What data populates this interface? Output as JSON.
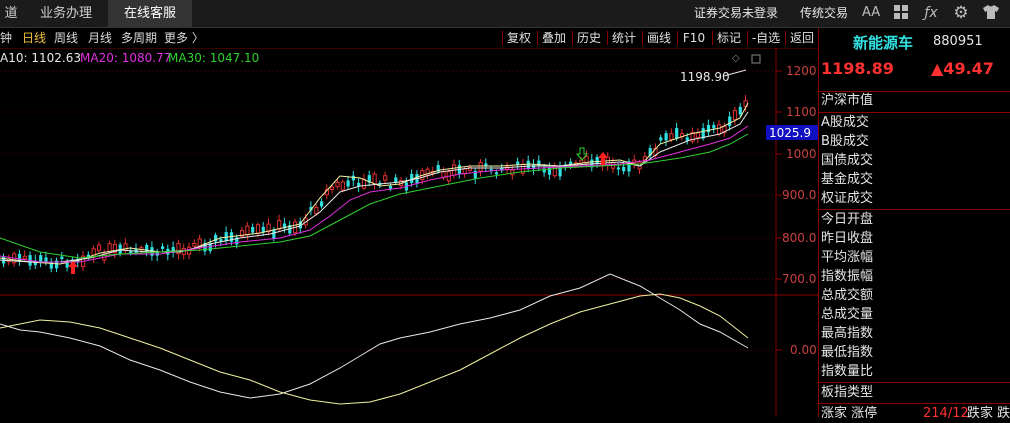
{
  "top_tabs": [
    "道",
    "业务办理",
    "在线客服"
  ],
  "top_right": {
    "login_label": "证券交易未登录",
    "classic_label": "传统交易",
    "font_size_label": "AA"
  },
  "periods": [
    "钟",
    "日线",
    "周线",
    "月线",
    "多周期",
    "更多 〉"
  ],
  "selected_period": "日线",
  "toolbar": [
    "复权",
    "叠加",
    "历史",
    "统计",
    "画线",
    "F10",
    "标记",
    "-自选",
    "返回"
  ],
  "ma_legend": [
    {
      "label": "A10: 1102.63",
      "color": "#e8e8e8"
    },
    {
      "label": "MA20: 1080.77",
      "color": "#e030e0"
    },
    {
      "label": "MA30: 1047.10",
      "color": "#30d030"
    }
  ],
  "price_axis": [
    "1200",
    "1100",
    "1000",
    "900.0",
    "800.0",
    "700.0"
  ],
  "current_price_tag": "1025.9",
  "high_annotation": "1198.90",
  "indicator_axis": [
    "0.00"
  ],
  "quote": {
    "name": "新能源车",
    "code": "880951",
    "price": "1198.89",
    "change": "▲49.47"
  },
  "panel_rows_a": [
    "沪深市值",
    "A股成交",
    "B股成交",
    "国债成交",
    "基金成交",
    "权证成交"
  ],
  "panel_rows_b": [
    "今日开盘",
    "昨日收盘",
    "平均涨幅",
    "指数振幅",
    "总成交额",
    "总成交量",
    "最高指数",
    "最低指数",
    "指数量比"
  ],
  "panel_rows_c": [
    "板指类型"
  ],
  "bottom_row": {
    "left": "涨家 涨停",
    "ratio": "214/12",
    "right": "跌家 跌"
  },
  "colors": {
    "up": "#e03030",
    "down": "#30e0e0",
    "accent": "#f0c040",
    "border": "#8b0000"
  }
}
